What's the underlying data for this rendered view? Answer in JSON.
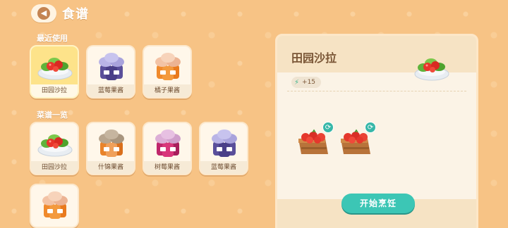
{
  "header": {
    "title": "食谱",
    "back_icon": "chevron-left-icon"
  },
  "recent": {
    "title": "最近使用",
    "items": [
      {
        "label": "田园沙拉",
        "icon": "salad-icon",
        "selected": true
      },
      {
        "label": "蓝莓果酱",
        "icon": "blueberry-jam-icon",
        "selected": false
      },
      {
        "label": "橘子果酱",
        "icon": "orange-jam-icon",
        "selected": false
      }
    ]
  },
  "catalog": {
    "title": "菜谱一览",
    "items": [
      {
        "label": "田园沙拉",
        "icon": "salad-icon"
      },
      {
        "label": "什锦果酱",
        "icon": "mixed-jam-icon"
      },
      {
        "label": "树莓果酱",
        "icon": "raspberry-jam-icon"
      },
      {
        "label": "蓝莓果酱",
        "icon": "blueberry-jam-icon"
      },
      {
        "label": "",
        "icon": "orange-jam-icon"
      }
    ]
  },
  "detail": {
    "title": "田园沙拉",
    "energy": "+15",
    "energy_icon": "lightning-icon",
    "ingredients": [
      {
        "icon": "tomato-crate-icon",
        "swap_icon": "refresh-icon"
      },
      {
        "icon": "tomato-crate-icon",
        "swap_icon": "refresh-icon"
      }
    ],
    "cook_label": "开始烹饪"
  },
  "colors": {
    "background": "#f7c385",
    "accent": "#3cc6b5",
    "selected_card": "#fde38a"
  }
}
